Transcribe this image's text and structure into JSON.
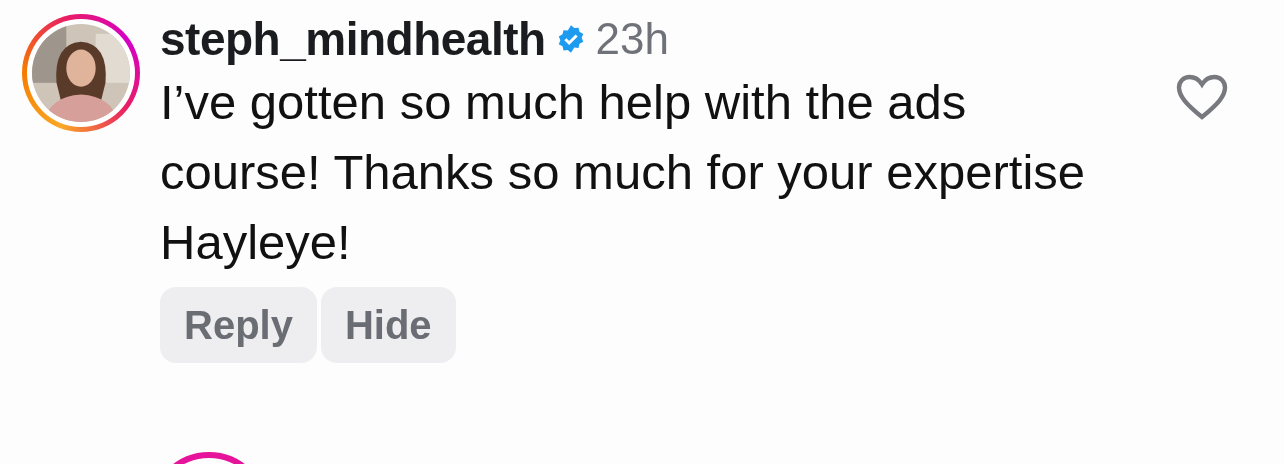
{
  "comment": {
    "username": "steph_mindhealth",
    "verified": true,
    "time": "23h",
    "text": "I’ve gotten so much help with the ads course! Thanks so much for your expertise Hayleye!",
    "liked": false,
    "actions": [
      "Reply",
      "Hide"
    ]
  }
}
